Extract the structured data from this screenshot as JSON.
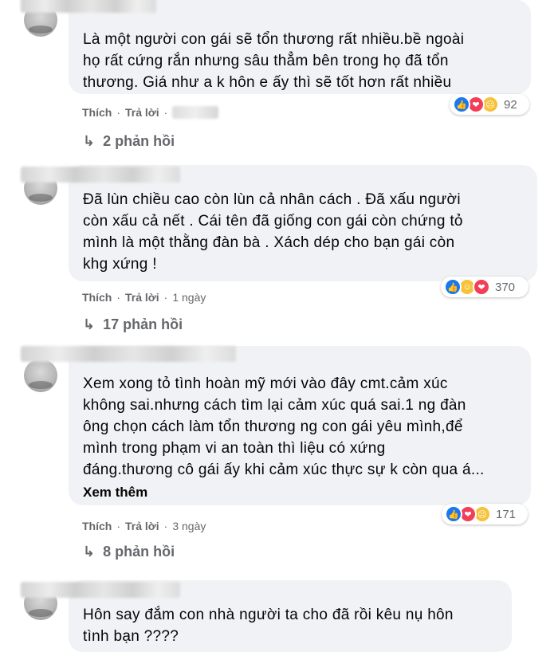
{
  "comments": [
    {
      "text_lines": [
        "Là một người con gái sẽ tổn thương rất nhiều.bề ngoài",
        "họ rất cứng rắn nhưng sâu thẳm bên trong họ đã tổn",
        "thương. Giá như a k hôn e ấy thì sẽ tốt hơn rất nhiều"
      ],
      "reactions": [
        "like",
        "love",
        "sad"
      ],
      "reaction_count": "92",
      "like_label": "Thích",
      "reply_label": "Trả lời",
      "time": "",
      "replies_label": "2 phản hồi"
    },
    {
      "text_lines": [
        "Đã lùn chiều cao còn lùn cả nhân cách . Đã xấu người",
        "còn xấu cả nết . Cái tên đã giống con gái còn chứng tỏ",
        "mình là một thằng đàn bà . Xách dép cho bạn gái còn",
        "khg xứng !"
      ],
      "reactions": [
        "like",
        "haha",
        "love"
      ],
      "reaction_count": "370",
      "like_label": "Thích",
      "reply_label": "Trả lời",
      "time": "1 ngày",
      "replies_label": "17 phản hồi"
    },
    {
      "text_lines": [
        "Xem xong tỏ tình hoàn mỹ mới vào đây cmt.cảm xúc",
        "không sai.nhưng cách tìm lại cảm xúc quá sai.1 ng đàn",
        "ông chọn cách làm tổn thương ng con gái yêu mình,để",
        "mình trong phạm vi an toàn thì liệu có xứng",
        "đáng.thương cô gái ấy khi cảm xúc thực sự k còn qua á..."
      ],
      "see_more": "Xem thêm",
      "reactions": [
        "like",
        "love",
        "sad"
      ],
      "reaction_count": "171",
      "like_label": "Thích",
      "reply_label": "Trả lời",
      "time": "3 ngày",
      "replies_label": "8 phản hồi"
    },
    {
      "text_lines": [
        "Hôn say đắm con nhà người ta cho đã rồi kêu nụ hôn",
        "tình bạn ????"
      ]
    }
  ],
  "icons": {
    "like": "thumbs-up-icon",
    "love": "heart-icon",
    "haha": "laugh-icon",
    "sad": "sad-face-icon",
    "reply": "reply-arrow-icon"
  },
  "colors": {
    "bubble": "#f0f2f5",
    "meta_text": "#65676b",
    "like": "#1877f2",
    "love": "#f33e58",
    "emoji": "#f7c13a"
  }
}
